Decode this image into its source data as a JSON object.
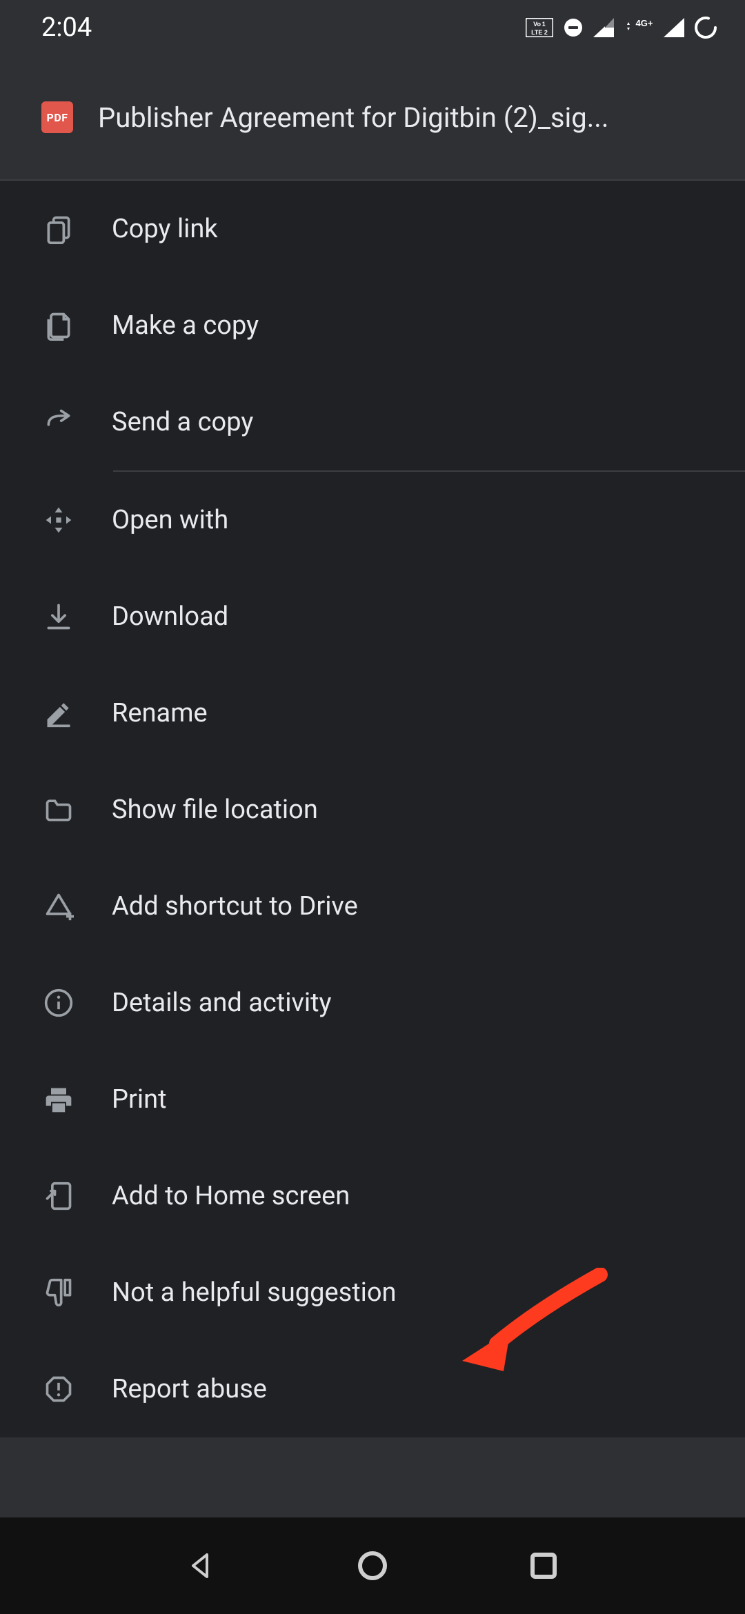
{
  "statusbar": {
    "time": "2:04",
    "volte_label": "VoLTE",
    "dnd_label": "dnd",
    "signal1_label": "signal",
    "net_label": "4G+",
    "signal2_label": "signal",
    "spinner_label": "loading"
  },
  "header": {
    "badge_text": "PDF",
    "title": "Publisher Agreement for Digitbin  (2)_sig..."
  },
  "groups": [
    {
      "items": [
        {
          "icon": "copy-link-icon",
          "label": "Copy link"
        },
        {
          "icon": "copy-file-icon",
          "label": "Make a copy"
        },
        {
          "icon": "send-arrow-icon",
          "label": "Send a copy"
        }
      ]
    },
    {
      "items": [
        {
          "icon": "open-with-icon",
          "label": "Open with"
        },
        {
          "icon": "download-icon",
          "label": "Download"
        },
        {
          "icon": "rename-icon",
          "label": "Rename"
        },
        {
          "icon": "folder-icon",
          "label": "Show file location"
        },
        {
          "icon": "add-shortcut-icon",
          "label": "Add shortcut to Drive"
        },
        {
          "icon": "info-icon",
          "label": "Details and activity"
        },
        {
          "icon": "print-icon",
          "label": "Print"
        },
        {
          "icon": "homescreen-icon",
          "label": "Add to Home screen"
        },
        {
          "icon": "thumb-down-icon",
          "label": "Not a helpful suggestion"
        },
        {
          "icon": "report-icon",
          "label": "Report abuse"
        }
      ]
    }
  ],
  "annotation": {
    "arrow_color": "#ff3b1f"
  },
  "nav": {
    "back": "back",
    "home": "home",
    "recent": "recent"
  }
}
